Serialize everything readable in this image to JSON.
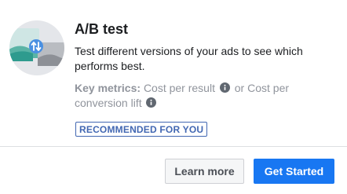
{
  "card": {
    "title": "A/B test",
    "description": "Test different versions of your ads to see which performs best.",
    "metrics_label": "Key metrics:",
    "metric_1": "Cost per result",
    "metric_separator": "or",
    "metric_2": "Cost per conversion lift",
    "badge": "RECOMMENDED FOR YOU"
  },
  "actions": {
    "learn_more": "Learn more",
    "get_started": "Get Started"
  },
  "icons": {
    "illustration": "ab-test-illustration-icon",
    "info": "info-icon"
  },
  "colors": {
    "primary": "#1877f2",
    "badge": "#4267b2",
    "muted": "#90949c"
  }
}
